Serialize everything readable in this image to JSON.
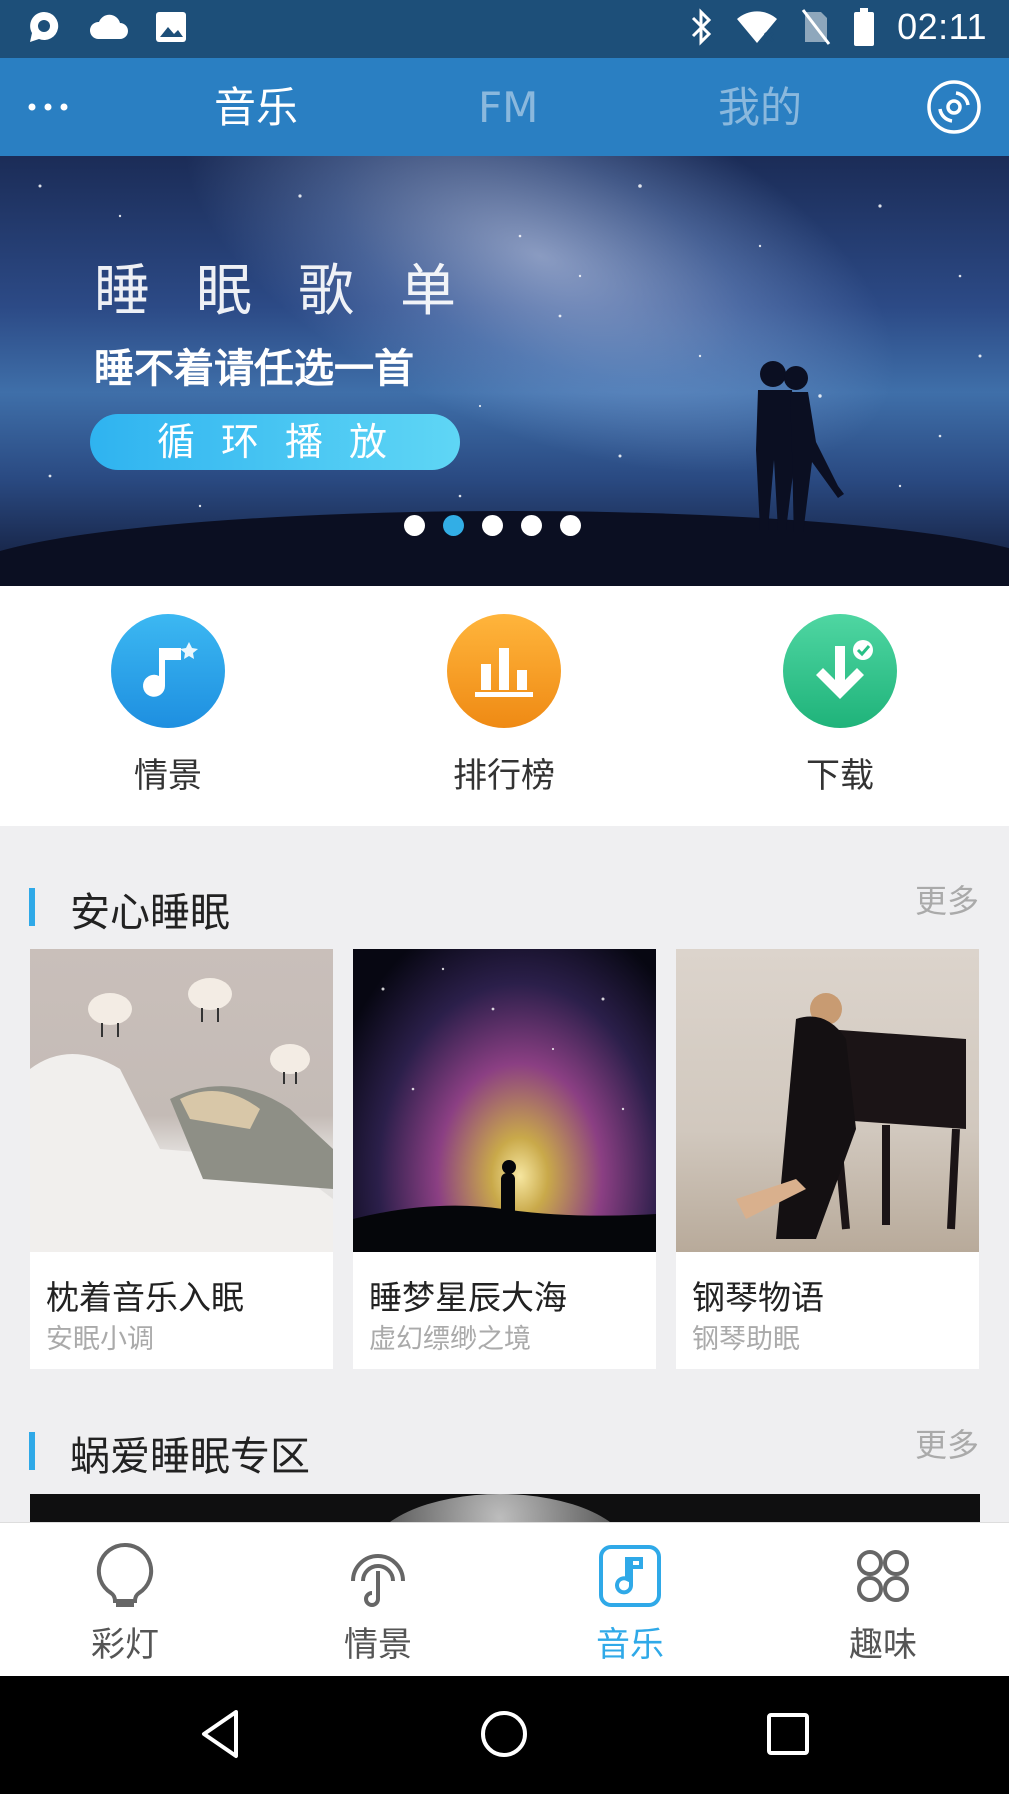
{
  "status_bar": {
    "time": "02:11",
    "left_icons": [
      "chat-bubble-icon",
      "cloud-icon",
      "image-icon"
    ],
    "right_icons": [
      "bluetooth-icon",
      "wifi-icon",
      "no-sim-icon",
      "battery-icon"
    ]
  },
  "top_nav": {
    "tabs": [
      {
        "label": "音乐",
        "active": true
      },
      {
        "label": "FM",
        "active": false
      },
      {
        "label": "我的",
        "active": false
      }
    ],
    "left_icon": "more-dots-icon",
    "right_icon": "disc-icon"
  },
  "banner": {
    "title": "睡眠歌单",
    "subtitle": "睡不着请任选一首",
    "button_label": "循环播放",
    "dots_total": 5,
    "dots_active_index": 1
  },
  "quick_entries": [
    {
      "label": "情景",
      "icon": "music-note-icon",
      "color": "#2196e6"
    },
    {
      "label": "排行榜",
      "icon": "bar-chart-icon",
      "color": "#f39a1f"
    },
    {
      "label": "下载",
      "icon": "download-icon",
      "color": "#27c086"
    }
  ],
  "section1": {
    "title": "安心睡眠",
    "more": "更多",
    "cards": [
      {
        "title": "枕着音乐入眠",
        "subtitle": "安眠小调"
      },
      {
        "title": "睡梦星辰大海",
        "subtitle": "虚幻缥缈之境"
      },
      {
        "title": "钢琴物语",
        "subtitle": "钢琴助眠"
      }
    ]
  },
  "section2": {
    "title": "蜗爱睡眠专区",
    "more": "更多"
  },
  "bottom_tabs": [
    {
      "label": "彩灯",
      "icon": "lightbulb-icon",
      "active": false
    },
    {
      "label": "情景",
      "icon": "headphones-icon",
      "active": false
    },
    {
      "label": "音乐",
      "icon": "music-note-icon",
      "active": true
    },
    {
      "label": "趣味",
      "icon": "grid-icon",
      "active": false
    }
  ],
  "colors": {
    "status_bar": "#1d4f79",
    "top_nav": "#2a7fc2",
    "accent": "#2fa9e8"
  }
}
